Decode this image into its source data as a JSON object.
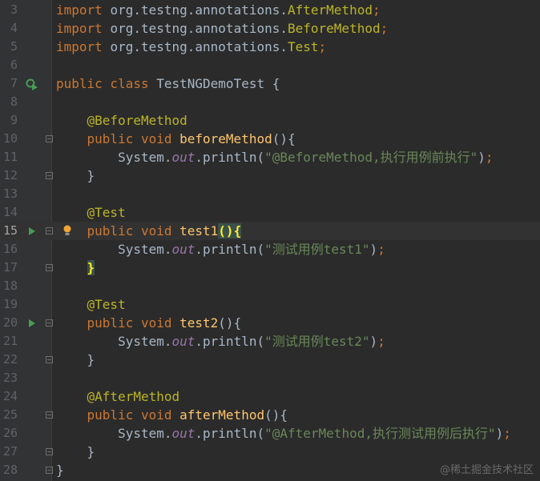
{
  "lines": [
    {
      "num": "3",
      "segments": [
        [
          "kw",
          "import "
        ],
        [
          "p",
          "org.testng.annotations."
        ],
        [
          "ann",
          "AfterMethod"
        ],
        [
          "kw",
          ";"
        ]
      ]
    },
    {
      "num": "4",
      "segments": [
        [
          "kw",
          "import "
        ],
        [
          "p",
          "org.testng.annotations."
        ],
        [
          "ann",
          "BeforeMethod"
        ],
        [
          "kw",
          ";"
        ]
      ]
    },
    {
      "num": "5",
      "segments": [
        [
          "kw",
          "import "
        ],
        [
          "p",
          "org.testng.annotations."
        ],
        [
          "ann",
          "Test"
        ],
        [
          "kw",
          ";"
        ]
      ]
    },
    {
      "num": "6",
      "segments": []
    },
    {
      "num": "7",
      "segments": [
        [
          "kw",
          "public class "
        ],
        [
          "p",
          "TestNGDemoTest {"
        ]
      ],
      "icon": "run-class-icon"
    },
    {
      "num": "8",
      "segments": []
    },
    {
      "num": "9",
      "segments": [
        [
          "p",
          "    "
        ],
        [
          "ann",
          "@BeforeMethod"
        ]
      ]
    },
    {
      "num": "10",
      "segments": [
        [
          "p",
          "    "
        ],
        [
          "kw",
          "public void "
        ],
        [
          "fn",
          "beforeMethod"
        ],
        [
          "p",
          "(){"
        ]
      ],
      "fold": true
    },
    {
      "num": "11",
      "segments": [
        [
          "p",
          "        System."
        ],
        [
          "fld",
          "out"
        ],
        [
          "p",
          ".println("
        ],
        [
          "str",
          "\"@BeforeMethod,执行用例前执行\""
        ],
        [
          "p",
          ")"
        ],
        [
          "kw",
          ";"
        ]
      ]
    },
    {
      "num": "12",
      "segments": [
        [
          "p",
          "    }"
        ]
      ],
      "fold": true
    },
    {
      "num": "13",
      "segments": []
    },
    {
      "num": "14",
      "segments": [
        [
          "p",
          "    "
        ],
        [
          "ann",
          "@Test"
        ]
      ]
    },
    {
      "num": "15",
      "segments": [
        [
          "p",
          "    "
        ],
        [
          "kw",
          "public void "
        ],
        [
          "fn",
          "test1"
        ],
        [
          "hl",
          "(){"
        ]
      ],
      "fold": true,
      "icon": "run-test-icon",
      "bulb": true,
      "current": true
    },
    {
      "num": "16",
      "segments": [
        [
          "p",
          "        System."
        ],
        [
          "fld",
          "out"
        ],
        [
          "p",
          ".println("
        ],
        [
          "str",
          "\"测试用例test1\""
        ],
        [
          "p",
          ")"
        ],
        [
          "kw",
          ";"
        ]
      ]
    },
    {
      "num": "17",
      "segments": [
        [
          "p",
          "    "
        ],
        [
          "hl",
          "}"
        ]
      ],
      "fold": true
    },
    {
      "num": "18",
      "segments": []
    },
    {
      "num": "19",
      "segments": [
        [
          "p",
          "    "
        ],
        [
          "ann",
          "@Test"
        ]
      ]
    },
    {
      "num": "20",
      "segments": [
        [
          "p",
          "    "
        ],
        [
          "kw",
          "public void "
        ],
        [
          "fn",
          "test2"
        ],
        [
          "p",
          "(){"
        ]
      ],
      "fold": true,
      "icon": "run-test-icon"
    },
    {
      "num": "21",
      "segments": [
        [
          "p",
          "        System."
        ],
        [
          "fld",
          "out"
        ],
        [
          "p",
          ".println("
        ],
        [
          "str",
          "\"测试用例test2\""
        ],
        [
          "p",
          ")"
        ],
        [
          "kw",
          ";"
        ]
      ]
    },
    {
      "num": "22",
      "segments": [
        [
          "p",
          "    }"
        ]
      ],
      "fold": true
    },
    {
      "num": "23",
      "segments": []
    },
    {
      "num": "24",
      "segments": [
        [
          "p",
          "    "
        ],
        [
          "ann",
          "@AfterMethod"
        ]
      ]
    },
    {
      "num": "25",
      "segments": [
        [
          "p",
          "    "
        ],
        [
          "kw",
          "public void "
        ],
        [
          "fn",
          "afterMethod"
        ],
        [
          "p",
          "(){"
        ]
      ],
      "fold": true
    },
    {
      "num": "26",
      "segments": [
        [
          "p",
          "        System."
        ],
        [
          "fld",
          "out"
        ],
        [
          "p",
          ".println("
        ],
        [
          "str",
          "\"@AfterMethod,执行测试用例后执行\""
        ],
        [
          "p",
          ")"
        ],
        [
          "kw",
          ";"
        ]
      ]
    },
    {
      "num": "27",
      "segments": [
        [
          "p",
          "    }"
        ]
      ],
      "fold": true
    },
    {
      "num": "28",
      "segments": [
        [
          "p",
          "}"
        ]
      ],
      "fold": true
    }
  ],
  "watermark": "@稀土掘金技术社区",
  "colors": {
    "background": "#2b2b2b",
    "keyword": "#cc7832",
    "annotation": "#bbb529",
    "method": "#ffc66d",
    "string": "#6a8759",
    "field": "#9876aa",
    "plain": "#a9b7c6",
    "run_icon": "#499c54"
  }
}
